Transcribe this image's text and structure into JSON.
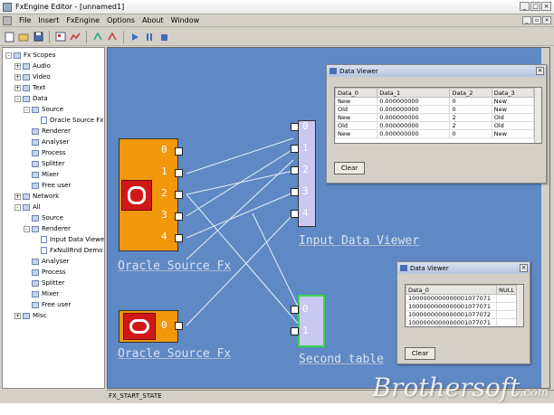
{
  "window": {
    "title": "FxEngine Editor - [unnamed1]"
  },
  "menu": [
    "File",
    "Insert",
    "FxEngine",
    "Options",
    "About",
    "Window"
  ],
  "toolbar": {
    "buttons": [
      "new-icon",
      "open-icon",
      "save-icon",
      "scope-icon",
      "graph-icon",
      "connect-icon",
      "disconnect-icon",
      "play-icon",
      "pause-icon",
      "stop-icon"
    ]
  },
  "tree": {
    "items": [
      {
        "label": "Fx Scopes",
        "level": 0,
        "expander": "-",
        "kind": "folder"
      },
      {
        "label": "Audio",
        "level": 1,
        "expander": "+",
        "kind": "folder"
      },
      {
        "label": "Video",
        "level": 1,
        "expander": "+",
        "kind": "folder"
      },
      {
        "label": "Text",
        "level": 1,
        "expander": "+",
        "kind": "folder"
      },
      {
        "label": "Data",
        "level": 1,
        "expander": "-",
        "kind": "folder"
      },
      {
        "label": "Source",
        "level": 2,
        "expander": "-",
        "kind": "folder"
      },
      {
        "label": "Oracle Source Fx",
        "level": 3,
        "expander": "",
        "kind": "doc"
      },
      {
        "label": "Renderer",
        "level": 2,
        "expander": "",
        "kind": "folder"
      },
      {
        "label": "Analyser",
        "level": 2,
        "expander": "",
        "kind": "folder"
      },
      {
        "label": "Process",
        "level": 2,
        "expander": "",
        "kind": "folder"
      },
      {
        "label": "Splitter",
        "level": 2,
        "expander": "",
        "kind": "folder"
      },
      {
        "label": "Mixer",
        "level": 2,
        "expander": "",
        "kind": "folder"
      },
      {
        "label": "Free user",
        "level": 2,
        "expander": "",
        "kind": "folder"
      },
      {
        "label": "Network",
        "level": 1,
        "expander": "+",
        "kind": "folder"
      },
      {
        "label": "All",
        "level": 1,
        "expander": "-",
        "kind": "folder"
      },
      {
        "label": "Source",
        "level": 2,
        "expander": "",
        "kind": "folder"
      },
      {
        "label": "Renderer",
        "level": 2,
        "expander": "-",
        "kind": "folder"
      },
      {
        "label": "Input Data Viewer",
        "level": 3,
        "expander": "",
        "kind": "doc"
      },
      {
        "label": "FxNullRnd Demo",
        "level": 3,
        "expander": "",
        "kind": "doc"
      },
      {
        "label": "Analyser",
        "level": 2,
        "expander": "",
        "kind": "folder"
      },
      {
        "label": "Process",
        "level": 2,
        "expander": "",
        "kind": "folder"
      },
      {
        "label": "Splitter",
        "level": 2,
        "expander": "",
        "kind": "folder"
      },
      {
        "label": "Mixer",
        "level": 2,
        "expander": "",
        "kind": "folder"
      },
      {
        "label": "Free user",
        "level": 2,
        "expander": "",
        "kind": "folder"
      },
      {
        "label": "Misc",
        "level": 1,
        "expander": "+",
        "kind": "folder"
      }
    ]
  },
  "canvas": {
    "nodes": {
      "oracle1": {
        "label": "Oracle Source Fx",
        "ports": [
          "0",
          "1",
          "2",
          "3",
          "4"
        ]
      },
      "oracle2": {
        "label": "Oracle Source Fx",
        "ports": [
          "0"
        ]
      },
      "input_viewer": {
        "label": "Input Data Viewer",
        "ports": [
          "0",
          "1",
          "2",
          "3",
          "4"
        ]
      },
      "second_table": {
        "label": "Second table",
        "ports": [
          "0",
          "1"
        ]
      }
    }
  },
  "data_viewer_1": {
    "title": "Data Viewer",
    "columns": [
      "Data_0",
      "Data_1",
      "Data_2",
      "Data_3"
    ],
    "rows": [
      [
        "New",
        "0.000000000",
        "0",
        "New"
      ],
      [
        "Old",
        "0.000000000",
        "0",
        "New"
      ],
      [
        "New",
        "0.000000000",
        "2",
        "Old"
      ],
      [
        "Old",
        "0.000000000",
        "2",
        "Old"
      ],
      [
        "New",
        "0.000000000",
        "0",
        "New"
      ]
    ],
    "clear_label": "Clear"
  },
  "data_viewer_2": {
    "title": "Data Viewer",
    "columns": [
      "Data_0",
      "NULL"
    ],
    "rows": [
      [
        "1000000000000001077071",
        ""
      ],
      [
        "1000000000000001077071",
        ""
      ],
      [
        "1000000000000001077072",
        ""
      ],
      [
        "1000000000000001077071",
        ""
      ]
    ],
    "clear_label": "Clear"
  },
  "status": {
    "text": "FX_START_STATE"
  },
  "watermark": {
    "text": "Brothersoft",
    "suffix": ".com"
  }
}
